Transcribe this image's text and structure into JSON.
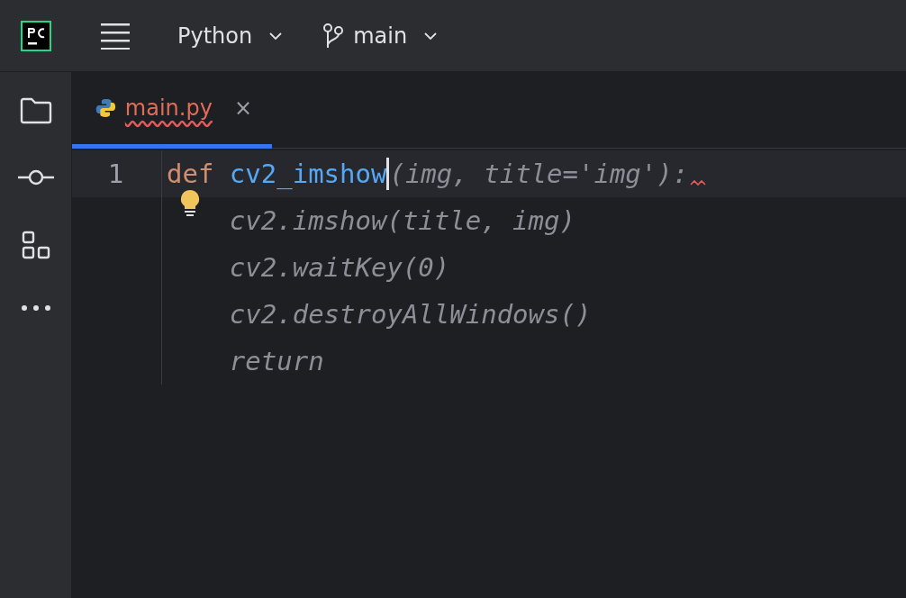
{
  "toolbar": {
    "project": "Python",
    "branch": "main"
  },
  "tabs": [
    {
      "label": "main.py",
      "selected": true,
      "error": true,
      "close": "×"
    }
  ],
  "editor": {
    "lines": [
      {
        "number": "1",
        "current": true,
        "error_mark": true,
        "bulb": false,
        "tokens": [
          {
            "kind": "keyword",
            "text": "def "
          },
          {
            "kind": "function",
            "text": "cv2_imshow"
          },
          {
            "kind": "caret"
          },
          {
            "kind": "ghost",
            "text": "(img, title='img'):"
          }
        ]
      },
      {
        "current": false,
        "error_mark": false,
        "bulb": true,
        "tokens": [
          {
            "kind": "ghost",
            "text": "    cv2.imshow(title, img)"
          }
        ]
      },
      {
        "current": false,
        "error_mark": false,
        "bulb": false,
        "tokens": [
          {
            "kind": "ghost",
            "text": "    cv2.waitKey(0)"
          }
        ]
      },
      {
        "current": false,
        "error_mark": false,
        "bulb": false,
        "tokens": [
          {
            "kind": "ghost",
            "text": "    cv2.destroyAllWindows()"
          }
        ]
      },
      {
        "current": false,
        "error_mark": false,
        "bulb": false,
        "tokens": [
          {
            "kind": "ghost",
            "text": "    return"
          }
        ]
      }
    ]
  }
}
